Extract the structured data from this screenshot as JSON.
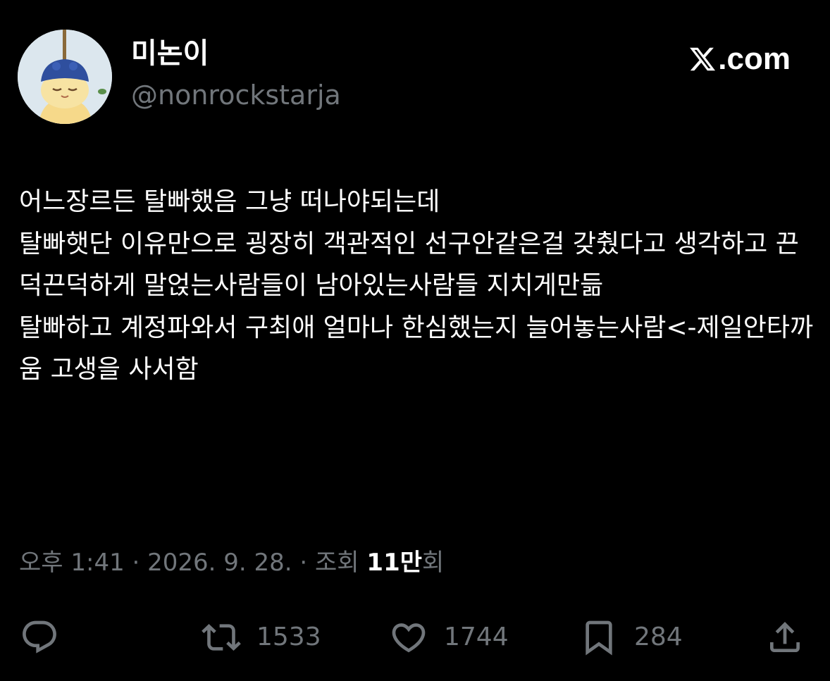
{
  "author": {
    "display_name": "미논이",
    "handle": "@nonrockstarja",
    "avatar_icon": "character-avatar"
  },
  "site": {
    "label": ".com",
    "logo_icon": "x-logo-icon"
  },
  "tweet": {
    "text": "어느장르든 탈빠했음 그냥 떠나야되는데\n탈빠햇단 이유만으로 굉장히 객관적인 선구안같은걸 갖췄다고 생각하고 끈덕끈덕하게 말얹는사람들이 남아있는사람들 지치게만듦\n탈빠하고 계정파와서 구최애 얼마나 한심했는지 늘어놓는사람<-제일안타까움 고생을 사서함"
  },
  "meta": {
    "timestamp": "오후 1:41 · 2026. 9. 28. · 조회 ",
    "views_count": "11만",
    "views_suffix": "회"
  },
  "actions": {
    "reply_icon": "reply-icon",
    "retweet_icon": "retweet-icon",
    "retweet_count": "1533",
    "like_icon": "heart-icon",
    "like_count": "1744",
    "bookmark_icon": "bookmark-icon",
    "bookmark_count": "284",
    "share_icon": "share-icon"
  },
  "colors": {
    "background": "#000000",
    "text_primary": "#ffffff",
    "text_secondary": "#71767b"
  }
}
